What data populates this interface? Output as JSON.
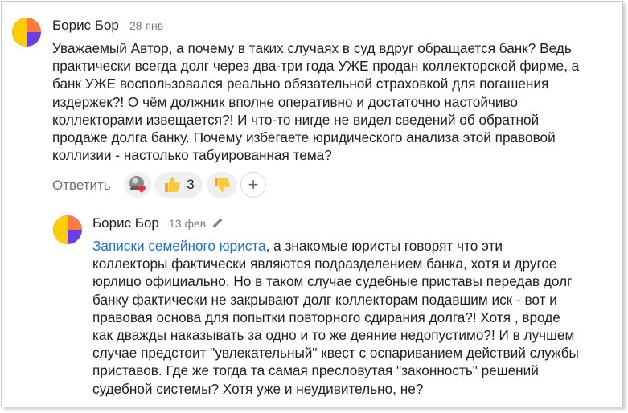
{
  "comment": {
    "author": "Борис Бор",
    "date": "28 янв",
    "lines": [
      "Уважаемый Автор, а почему в таких случаях в суд вдруг обращается банк? Ведь",
      "практически всегда долг через два-три года УЖЕ продан коллекторской фирме, а",
      "банк УЖЕ воспользовался реально обязательной страховкой для погашения",
      "издержек?! О чём должник вполне оперативно и достаточно настойчиво",
      "коллекторами извещается?! И что-то нигде не видел сведений об обратной",
      "продаже долга банку. Почему избегаете юридического анализа этой правовой",
      "коллизии - настолько табуированная тема?"
    ],
    "reply_label": "Ответить",
    "reactions": [
      {
        "icon": "heart-reaction-avatar-icon",
        "count": ""
      },
      {
        "icon": "thumbs-up-emoji-icon",
        "count": "3"
      },
      {
        "icon": "thumbs-down-emoji-icon",
        "count": ""
      }
    ],
    "add_reaction": "+"
  },
  "reply": {
    "author": "Борис Бор",
    "date": "13 фев",
    "edited_icon": "pencil-icon",
    "mention": "Записки семейного юриста",
    "first_line_rest": ", а знакомые юристы говорят что эти",
    "lines": [
      "коллекторы фактически являются подразделением банка, хотя и другое",
      "юрлицо официально. Но в таком случае судебные приставы передав долг",
      "банку фактически не закрывают долг коллекторам подавшим иск - вот и",
      "правовая основа для попытки повторного сдирания долга?! Хотя , вроде",
      "как дважды наказывать за одно и то же деяние недопустимо?! И в лучшем",
      "случае предстоит \"увлекательный\" квест с оспариванием действий службы",
      "приставов. Где же тогда та самая пресловутая \"законность\" решений",
      "судебной системы? Хотя уже и неудивительно, не?"
    ]
  },
  "colors": {
    "link": "#1f6fd1",
    "avatar_yellow": "#ffcc00",
    "avatar_purple": "#6a3de8",
    "avatar_orange": "#ff7a3d"
  }
}
